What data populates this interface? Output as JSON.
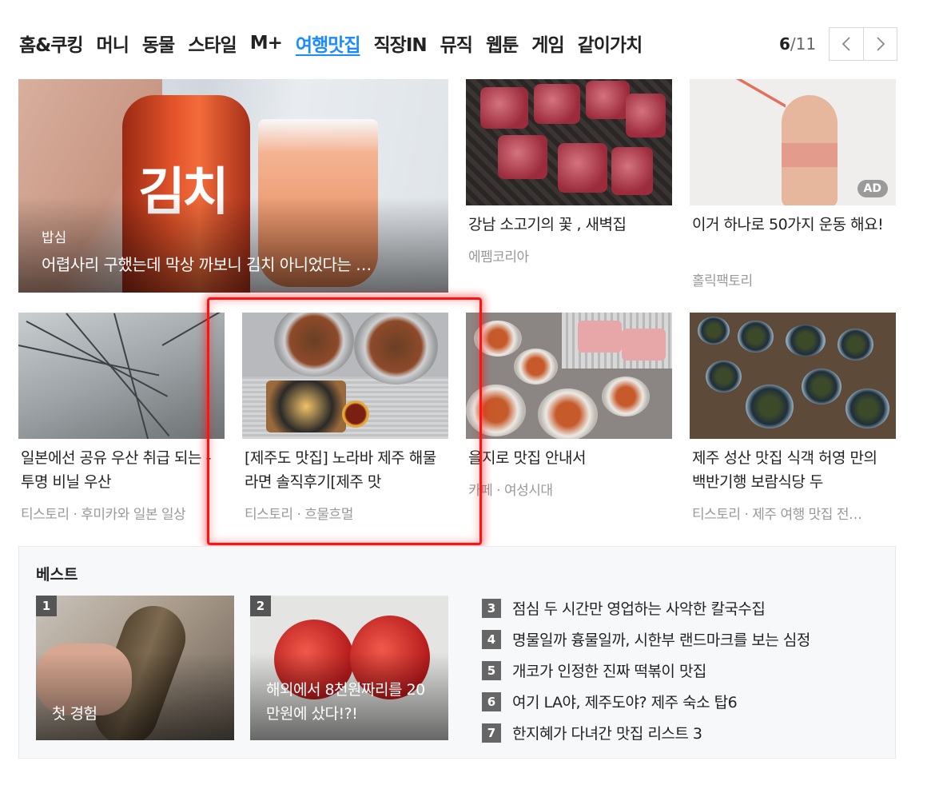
{
  "nav": {
    "items": [
      "홈&쿠킹",
      "머니",
      "동물",
      "스타일",
      "M+",
      "여행맛집",
      "직장IN",
      "뮤직",
      "웹툰",
      "게임",
      "같이가치"
    ],
    "active_index": 5
  },
  "pager": {
    "current": "6",
    "total": "/11",
    "prev_icon": "chevron-left-icon",
    "next_icon": "chevron-right-icon"
  },
  "hero": {
    "can_text": "김치",
    "category": "밥심",
    "title": "어렵사리 구했는데 막상 까보니 김치 아니었다는 …"
  },
  "cards": [
    {
      "title": "강남 소고기의 꽃 , 새벽집",
      "source": "에펨코리아"
    },
    {
      "title": "이거 하나로 50가지 운동 해요!",
      "source": "홀릭팩토리",
      "badge": "AD"
    },
    {
      "title": "일본에선 공유 우산 취급 되는 - 투명 비닐 우산",
      "source": "티스토리 · 후미카와 일본 일상"
    },
    {
      "title": "[제주도 맛집] 노라바 제주 해물라면 솔직후기[제주 맛",
      "source": "티스토리 · 흐물흐멀"
    },
    {
      "title": "을지로 맛집 안내서",
      "source": "카페 · 여성시대"
    },
    {
      "title": "제주 성산 맛집 식객 허영 만의 백반기행 보람식당 두",
      "source": "티스토리 · 제주 여행 맛집 전…"
    }
  ],
  "best": {
    "title": "베스트",
    "cards": [
      {
        "num": "1",
        "caption": "첫 경험"
      },
      {
        "num": "2",
        "caption": "해외에서 8천원짜리를 20만원에 샀다!?!"
      }
    ],
    "list": [
      {
        "num": "3",
        "text": "점심 두 시간만 영업하는 사악한 칼국수집"
      },
      {
        "num": "4",
        "text": "명물일까 흉물일까, 시한부 랜드마크를 보는 심정"
      },
      {
        "num": "5",
        "text": "개코가 인정한 진짜 떡볶이 맛집"
      },
      {
        "num": "6",
        "text": "여기 LA야, 제주도야? 제주 숙소 탑6"
      },
      {
        "num": "7",
        "text": "한지혜가 다녀간 맛집 리스트 3"
      }
    ]
  },
  "colors": {
    "active_nav": "#1a8cff",
    "highlight": "#ff1212"
  }
}
